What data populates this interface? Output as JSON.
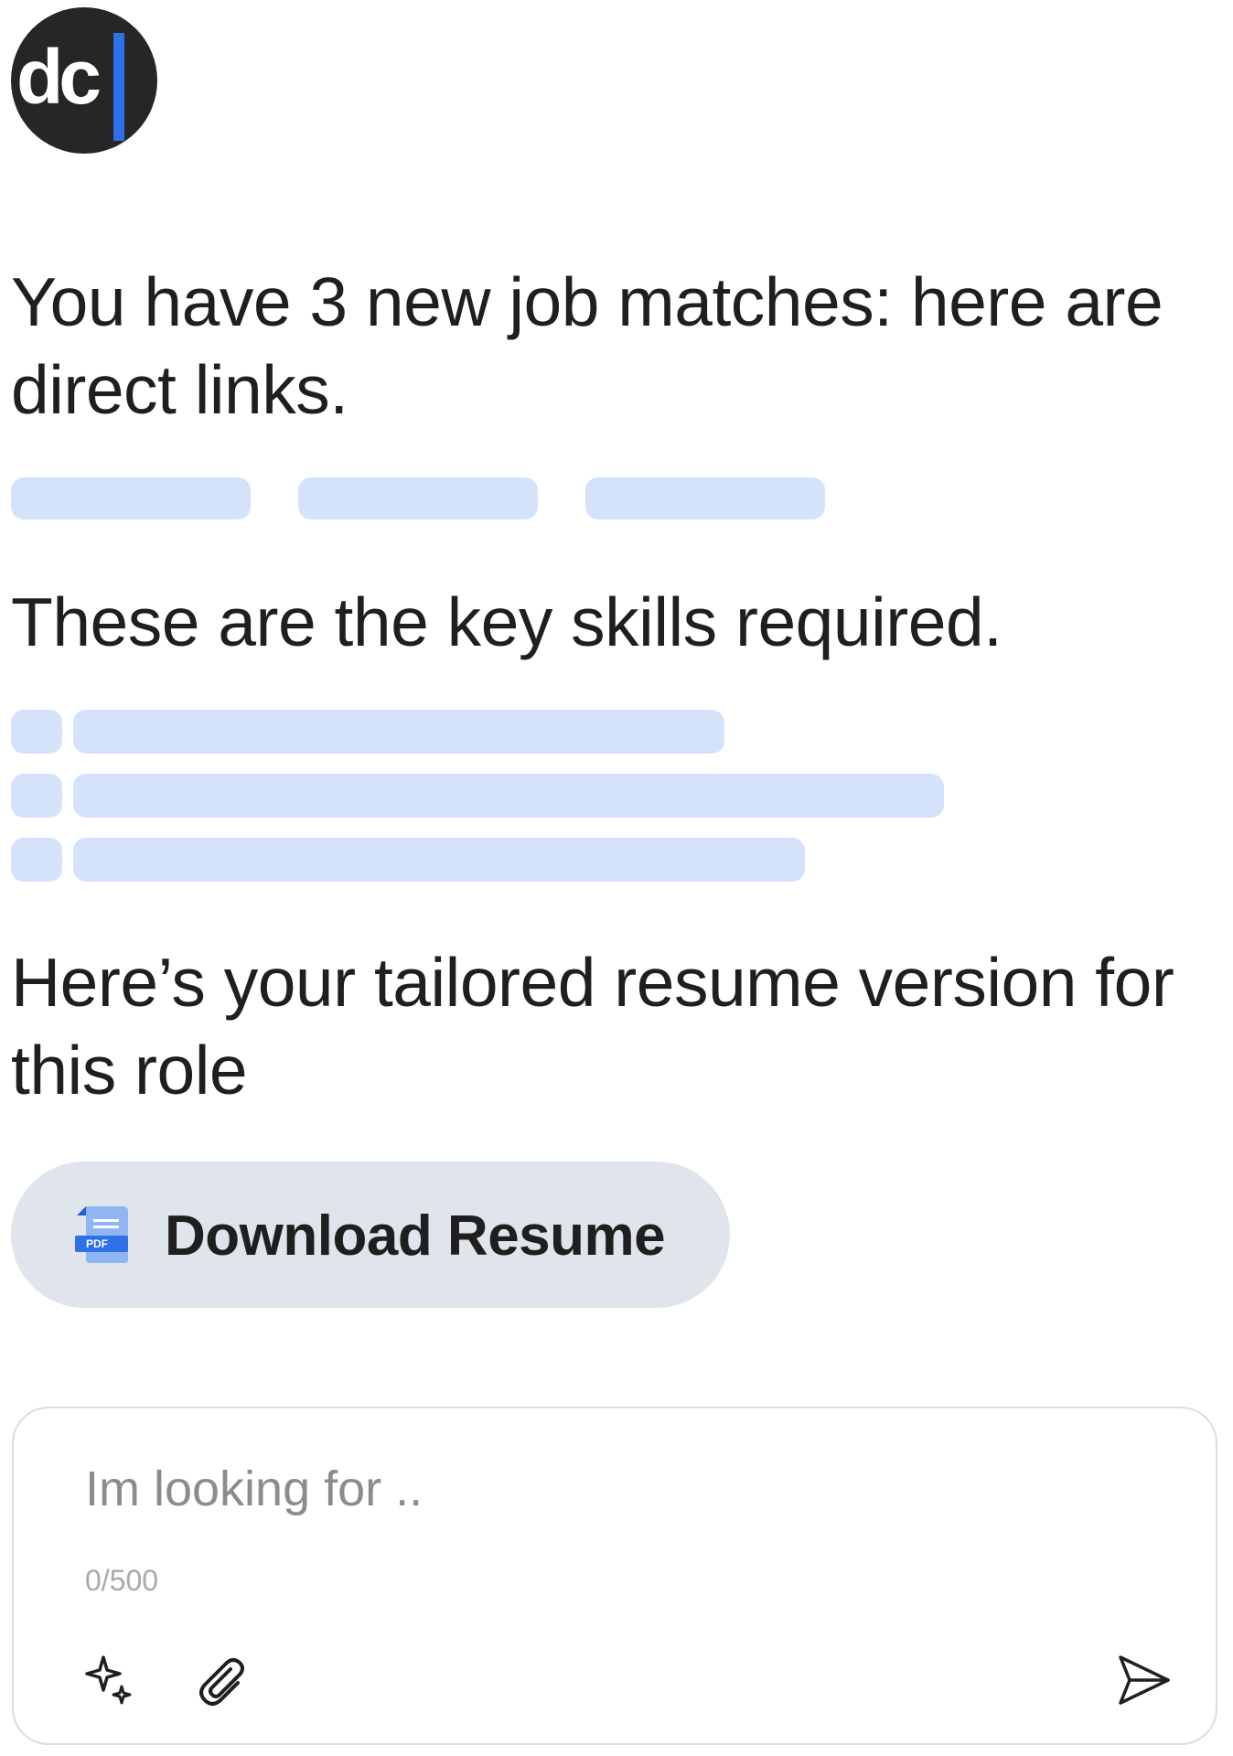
{
  "app": {
    "logo_text": "dc",
    "accent_color": "#2f6fe8"
  },
  "messages": {
    "job_matches": "You have 3 new job matches: here are direct links.",
    "skills": "These are the key skills required.",
    "resume": "Here’s your tailored resume version for this role"
  },
  "download": {
    "label": "Download Resume",
    "icon_label": "PDF",
    "icon": "pdf-file-icon"
  },
  "composer": {
    "placeholder": "Im looking for ..",
    "value": "",
    "counter": "0/500",
    "icons": [
      "sparkle-icon",
      "paperclip-icon",
      "send-icon"
    ]
  },
  "colors": {
    "skeleton": "#d4e2fa",
    "button_bg": "#dfe5ea",
    "avatar_bg": "#262626"
  }
}
